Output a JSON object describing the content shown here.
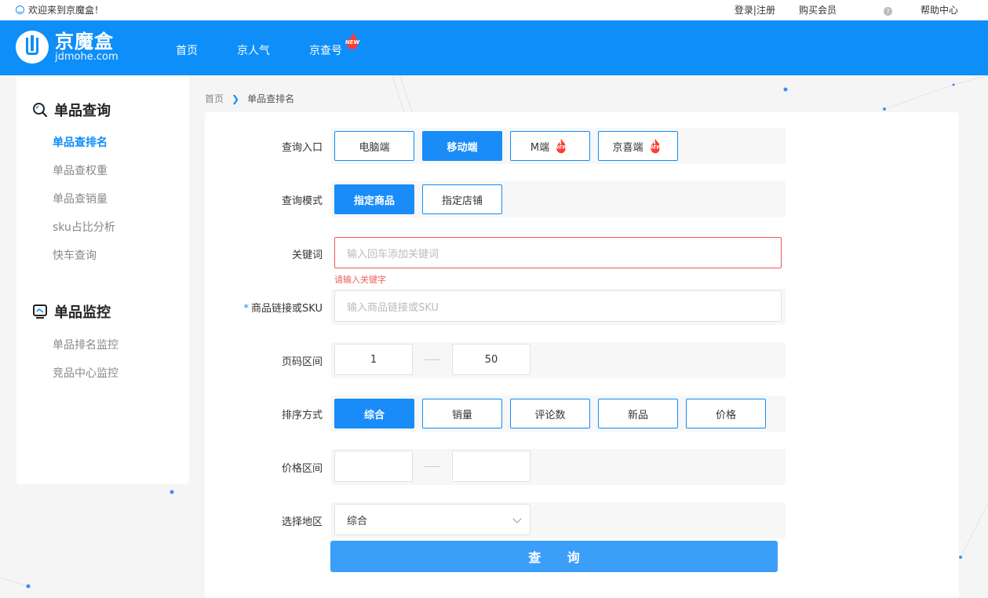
{
  "topbar": {
    "welcome": "欢迎来到京魔盒！",
    "login": "登录|注册",
    "buy": "购买会员",
    "help": "帮助中心"
  },
  "header": {
    "logo_cn": "京魔盒",
    "logo_en": "jdmohe.com",
    "nav": [
      "首页",
      "京人气",
      "京查号"
    ],
    "new_badge": "NEW"
  },
  "sidebar": {
    "section1_title": "单品查询",
    "section1_items": [
      "单品查排名",
      "单品查权重",
      "单品查销量",
      "sku占比分析",
      "快车查询"
    ],
    "section2_title": "单品监控",
    "section2_items": [
      "单品排名监控",
      "竞品中心监控"
    ]
  },
  "breadcrumb": {
    "home": "首页",
    "current": "单品查排名"
  },
  "form": {
    "entry": {
      "label": "查询入口",
      "options": [
        "电脑端",
        "移动端",
        "M端",
        "京喜端"
      ],
      "selected": "移动端"
    },
    "mode": {
      "label": "查询模式",
      "options": [
        "指定商品",
        "指定店铺"
      ],
      "selected": "指定商品"
    },
    "keyword": {
      "label": "关键词",
      "placeholder": "输入回车添加关键词",
      "error": "请输入关键字"
    },
    "sku": {
      "required_mark": "*",
      "label": "商品链接或SKU",
      "placeholder": "输入商品链接或SKU"
    },
    "pages": {
      "label": "页码区间",
      "from": "1",
      "to": "50"
    },
    "sort": {
      "label": "排序方式",
      "options": [
        "综合",
        "销量",
        "评论数",
        "新品",
        "价格"
      ],
      "selected": "综合"
    },
    "price": {
      "label": "价格区间",
      "from": "",
      "to": ""
    },
    "region": {
      "label": "选择地区",
      "value": "综合"
    },
    "submit": "查 询"
  },
  "colors": {
    "primary": "#0e8ef8",
    "error": "#f05a5a",
    "fire": "#ff3b2f"
  }
}
